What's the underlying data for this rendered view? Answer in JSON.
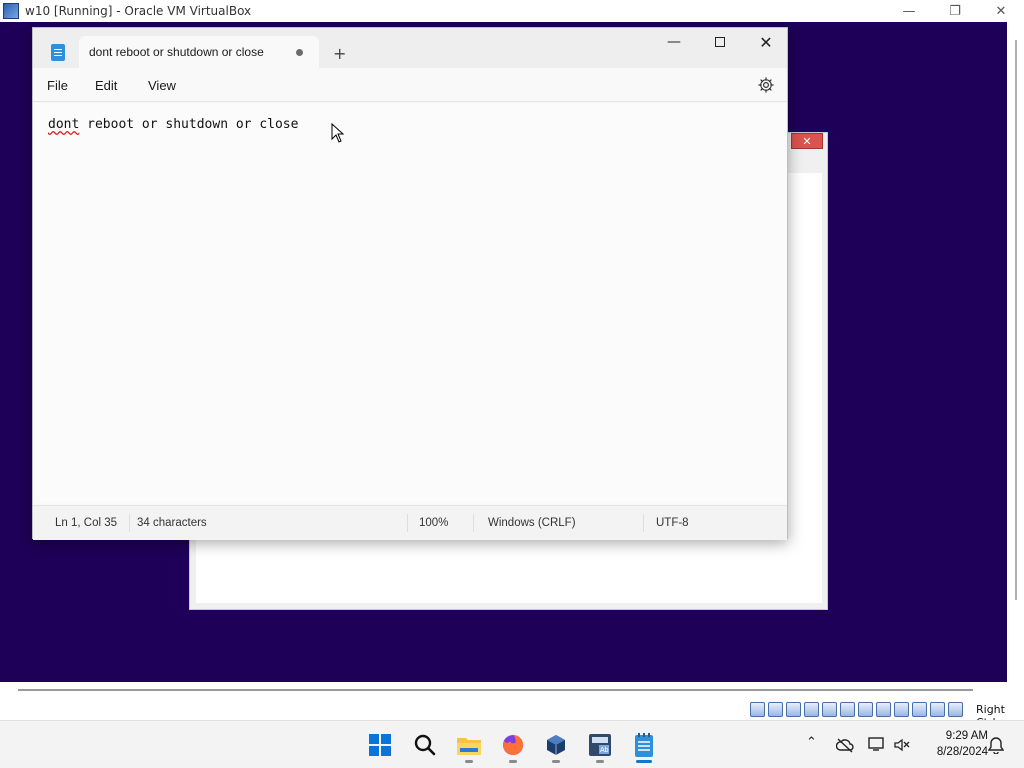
{
  "host": {
    "title": "w10 [Running] - Oracle VM VirtualBox",
    "host_key": "Right Ctrl"
  },
  "notepad": {
    "tab_title": "dont reboot or shutdown or close",
    "new_tab": "+",
    "menu": {
      "file": "File",
      "edit": "Edit",
      "view": "View"
    },
    "content": {
      "misspelled_word": "dont",
      "rest": " reboot or shutdown or close"
    },
    "status": {
      "position": "Ln 1, Col 35",
      "characters": "34 characters",
      "zoom": "100%",
      "line_endings": "Windows (CRLF)",
      "encoding": "UTF-8"
    }
  },
  "taskbar": {
    "time": "9:29 AM",
    "date": "8/28/2024",
    "apps": [
      "start-icon",
      "search-icon",
      "file-explorer-icon",
      "firefox-icon",
      "virtualbox-icon",
      "calculator-app-icon",
      "notepad-icon"
    ]
  },
  "colors": {
    "desktop": "#1e0058",
    "accent": "#0a74da"
  }
}
